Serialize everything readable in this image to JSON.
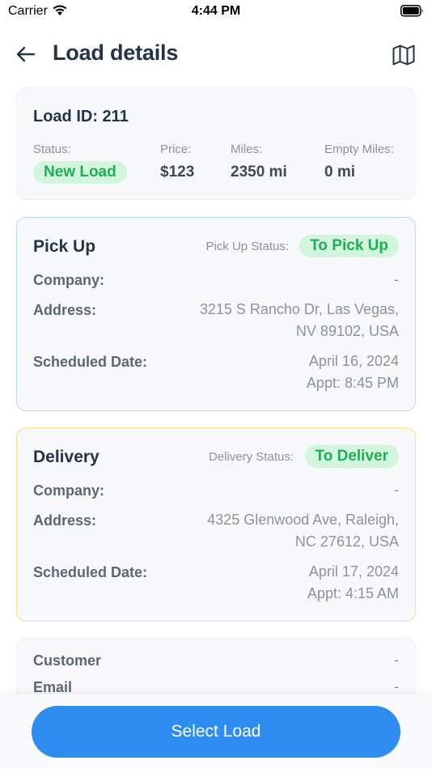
{
  "status_bar": {
    "carrier": "Carrier",
    "time": "4:44 PM"
  },
  "header": {
    "title": "Load details",
    "back_icon": "arrow-left-icon",
    "map_icon": "map-icon"
  },
  "summary": {
    "load_id": "Load ID: 211",
    "status_label": "Status:",
    "status_value": "New Load",
    "price_label": "Price:",
    "price_value": "$123",
    "miles_label": "Miles:",
    "miles_value": "2350 mi",
    "empty_miles_label": "Empty Miles:",
    "empty_miles_value": "0 mi"
  },
  "pickup": {
    "title": "Pick Up",
    "status_label": "Pick Up Status:",
    "status_value": "To Pick Up",
    "company_label": "Company:",
    "company_value": "-",
    "address_label": "Address:",
    "address_line1": "3215 S Rancho Dr, Las Vegas,",
    "address_line2": "NV 89102, USA",
    "date_label": "Scheduled Date:",
    "date_value": "April 16, 2024",
    "appt_value": "Appt: 8:45 PM",
    "border_color": "#b7dcf5"
  },
  "delivery": {
    "title": "Delivery",
    "status_label": "Delivery Status:",
    "status_value": "To Deliver",
    "company_label": "Company:",
    "company_value": "-",
    "address_label": "Address:",
    "address_line1": "4325 Glenwood Ave, Raleigh,",
    "address_line2": "NC 27612, USA",
    "date_label": "Scheduled Date:",
    "date_value": "April 17, 2024",
    "appt_value": "Appt: 4:15 AM",
    "border_color": "#f7df8f"
  },
  "customer": {
    "customer_label": "Customer",
    "customer_value": "-",
    "email_label": "Email",
    "email_value": "-"
  },
  "footer": {
    "select_label": "Select Load",
    "accent_color": "#2f8cf0"
  }
}
